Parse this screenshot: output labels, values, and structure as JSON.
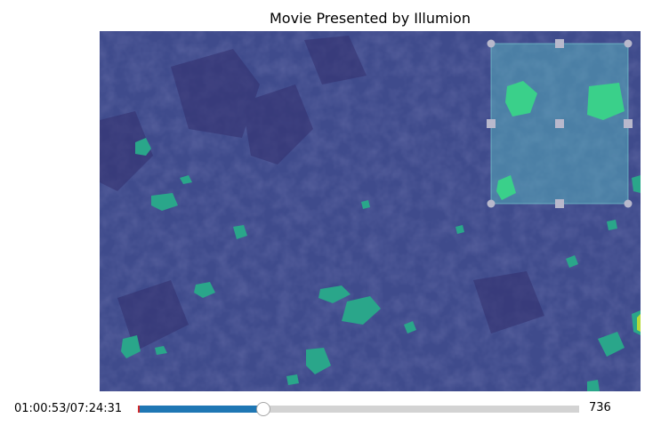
{
  "figure": {
    "title": "Movie Presented by Illumion"
  },
  "movie": {
    "colormap": "viridis",
    "background_color": "#3e4a8a",
    "blob_color": "#2aa68a",
    "roi_color": "#5ec8c8"
  },
  "slider": {
    "time_label": "01:00:53/07:24:31",
    "frame_value": "736",
    "position_fraction": 0.284,
    "fill_color": "#1f77b4",
    "track_color": "#d3d3d3",
    "init_marker_color": "#d62728"
  }
}
